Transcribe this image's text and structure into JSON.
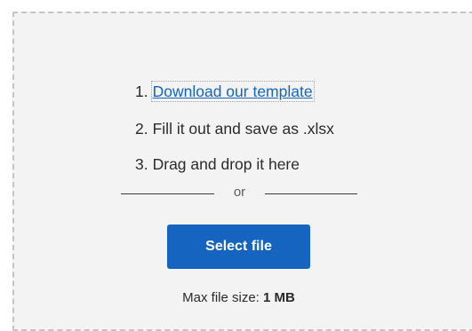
{
  "steps": [
    {
      "number": "1.",
      "text": "Download our template"
    },
    {
      "number": "2.",
      "text": "Fill it out and save as .xlsx"
    },
    {
      "number": "3.",
      "text": "Drag and drop it here"
    }
  ],
  "divider_text": "or",
  "select_button_label": "Select file",
  "max_size": {
    "label": "Max file size:",
    "value": "1 MB"
  },
  "colors": {
    "accent": "#1565c0",
    "dropzone_bg": "#f3f3f3",
    "dropzone_border": "#c4c4c4",
    "text": "#2b2b2b"
  }
}
